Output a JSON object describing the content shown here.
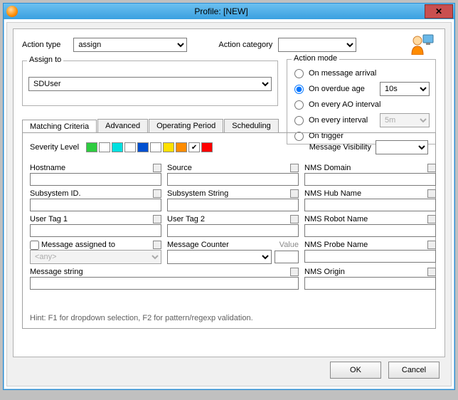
{
  "window": {
    "title": "Profile: [NEW]"
  },
  "top": {
    "action_type_label": "Action type",
    "action_type_value": "assign",
    "action_category_label": "Action category",
    "action_category_value": ""
  },
  "assign": {
    "legend": "Assign to",
    "value": "SDUser"
  },
  "mode": {
    "legend": "Action mode",
    "items": {
      "on_arrival": "On message arrival",
      "on_overdue": "On overdue age",
      "overdue_value": "10s",
      "on_ao": "On every AO interval",
      "on_interval": "On every interval",
      "interval_value": "5m",
      "on_trigger": "On trigger"
    },
    "selected": "on_overdue"
  },
  "tabs": {
    "items": [
      "Matching Criteria",
      "Advanced",
      "Operating Period",
      "Scheduling"
    ],
    "active": 0
  },
  "criteria": {
    "severity_label": "Severity Level",
    "msg_vis_label": "Message Visibility",
    "msg_vis_value": "",
    "fields": {
      "hostname": "Hostname",
      "source": "Source",
      "nms_domain": "NMS Domain",
      "subsystem_id": "Subsystem ID.",
      "subsystem_string": "Subsystem String",
      "nms_hub": "NMS Hub Name",
      "usertag1": "User Tag 1",
      "usertag2": "User Tag 2",
      "nms_robot": "NMS Robot Name",
      "msg_assigned": "Message assigned to",
      "msg_assigned_value": "<any>",
      "msg_counter": "Message Counter",
      "value_lbl": "Value",
      "nms_probe": "NMS Probe Name",
      "msg_string": "Message string",
      "nms_origin": "NMS Origin"
    },
    "severity_colors": [
      "#2ecc40",
      "#ffffff",
      "#00e0e0",
      "#ffffff",
      "#0050d0",
      "#ffffff",
      "#ffe000",
      "#ff8c00",
      "#ffffff",
      "#ff0000"
    ],
    "severity_checked": [
      false,
      false,
      false,
      false,
      false,
      false,
      false,
      false,
      true,
      false
    ]
  },
  "hint": "Hint: F1 for dropdown selection, F2 for pattern/regexp validation.",
  "buttons": {
    "ok": "OK",
    "cancel": "Cancel"
  }
}
